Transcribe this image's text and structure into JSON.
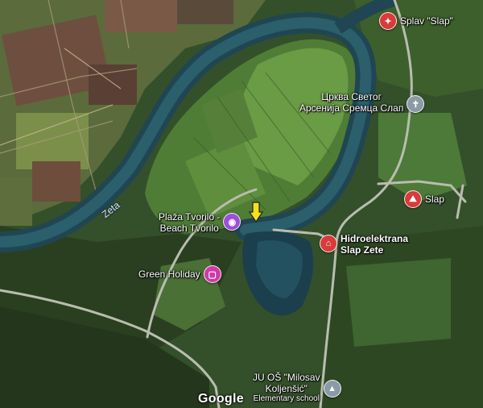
{
  "map": {
    "river_label": "Zeta",
    "attribution": "Google",
    "places": {
      "splav": {
        "label": "Splav \"Slap\"",
        "icon": "restaurant-icon",
        "color": "#d93a3a"
      },
      "church": {
        "label_line1": "Црква Светог",
        "label_line2": "Арсенија Сремца Слап",
        "icon": "cross-icon",
        "color": "#8a9aa6"
      },
      "slap": {
        "label": "Slap",
        "icon": "lodging-icon",
        "color": "#d93a3a"
      },
      "beach": {
        "label_line1": "Plaža Tvorilo -",
        "label_line2": "Beach Tvorilo",
        "icon": "camera-icon",
        "color": "#9b4fd6"
      },
      "hydro": {
        "label_line1": "Hidroelektrana",
        "label_line2": "Slap Zete",
        "icon": "landmark-icon",
        "color": "#d93a3a"
      },
      "green_holiday": {
        "label": "Green Holiday",
        "icon": "bed-icon",
        "color": "#d03aa8"
      },
      "school": {
        "label_line1": "JU OŠ \"Milosav",
        "label_line2": "Koljenšić\"",
        "label_line3": "Elementary school",
        "icon": "school-icon",
        "color": "#8a9aa6"
      }
    },
    "marker": {
      "icon": "yellow-arrow-marker-icon",
      "color": "#f5e21a"
    }
  }
}
